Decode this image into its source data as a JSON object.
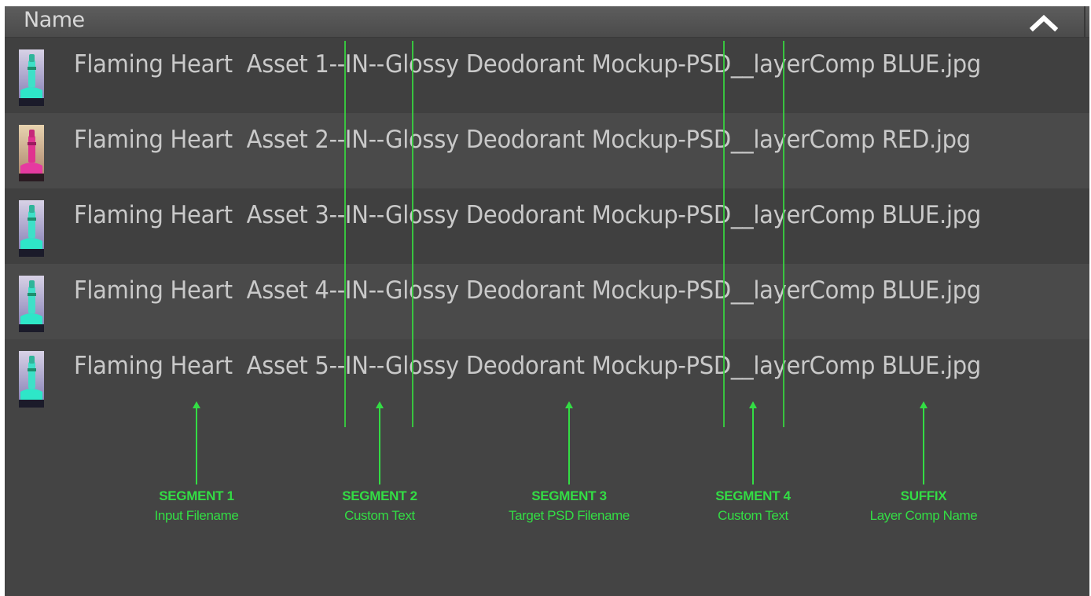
{
  "header": {
    "column_label": "Name",
    "sort_icon": "chevron-up-icon"
  },
  "files": [
    {
      "name": "Flaming Heart  Asset 1--IN--Glossy Deodorant Mockup-PSD__layerComp BLUE.jpg",
      "thumb_color": "blue"
    },
    {
      "name": "Flaming Heart  Asset 2--IN--Glossy Deodorant Mockup-PSD__layerComp RED.jpg",
      "thumb_color": "red"
    },
    {
      "name": "Flaming Heart  Asset 3--IN--Glossy Deodorant Mockup-PSD__layerComp BLUE.jpg",
      "thumb_color": "blue"
    },
    {
      "name": "Flaming Heart  Asset 4--IN--Glossy Deodorant Mockup-PSD__layerComp BLUE.jpg",
      "thumb_color": "blue"
    },
    {
      "name": "Flaming Heart  Asset 5--IN--Glossy Deodorant Mockup-PSD__layerComp BLUE.jpg",
      "thumb_color": "blue"
    }
  ],
  "annotations": [
    {
      "title": "SEGMENT 1",
      "subtitle": "Input Filename"
    },
    {
      "title": "SEGMENT 2",
      "subtitle": "Custom Text"
    },
    {
      "title": "SEGMENT 3",
      "subtitle": "Target PSD Filename"
    },
    {
      "title": "SEGMENT 4",
      "subtitle": "Custom Text"
    },
    {
      "title": "SUFFIX",
      "subtitle": "Layer Comp Name"
    }
  ],
  "colors": {
    "panel_bg": "#444444",
    "row_text": "#c9c9c9",
    "annotation": "#33dd44",
    "blue_thumb": "#3fe0c8",
    "red_thumb": "#e0338f"
  }
}
